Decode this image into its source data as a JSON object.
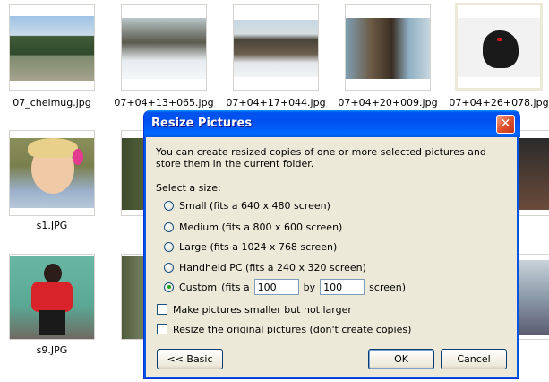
{
  "thumbnails": [
    {
      "name": "07_chelmug.jpg",
      "scene": "forest-road"
    },
    {
      "name": "07+04+13+065.jpg",
      "scene": "snow-trees"
    },
    {
      "name": "07+04+17+044.jpg",
      "scene": "river-snow"
    },
    {
      "name": "07+04+20+009.jpg",
      "scene": "bark"
    },
    {
      "name": "07+04+26+078.jpg",
      "scene": "bird"
    },
    {
      "name": "s1.JPG",
      "scene": "child"
    },
    {
      "name": "s9.JPG",
      "scene": "woman-red"
    }
  ],
  "dialog": {
    "title": "Resize Pictures",
    "close_glyph": "✕",
    "description": "You can create resized copies of one or more selected pictures and store them in the current folder.",
    "select_label": "Select a size:",
    "options": [
      {
        "label": "Small (fits a 640 x 480 screen)",
        "selected": false
      },
      {
        "label": "Medium (fits a 800 x 600 screen)",
        "selected": false
      },
      {
        "label": "Large (fits a 1024 x 768 screen)",
        "selected": false
      },
      {
        "label": "Handheld PC (fits a 240 x 320 screen)",
        "selected": false
      }
    ],
    "custom": {
      "label": "Custom",
      "prefix": "(fits a",
      "width": "100",
      "by": "by",
      "height": "100",
      "suffix": "screen)",
      "selected": true
    },
    "checkboxes": [
      {
        "label": "Make pictures smaller but not larger",
        "checked": false
      },
      {
        "label": "Resize the original pictures (don't create copies)",
        "checked": false
      }
    ],
    "buttons": {
      "basic": "<< Basic",
      "ok": "OK",
      "cancel": "Cancel"
    }
  },
  "colors": {
    "title_bar": "#0054e3",
    "dialog_bg": "#ece9d8",
    "close": "#e0542e"
  }
}
